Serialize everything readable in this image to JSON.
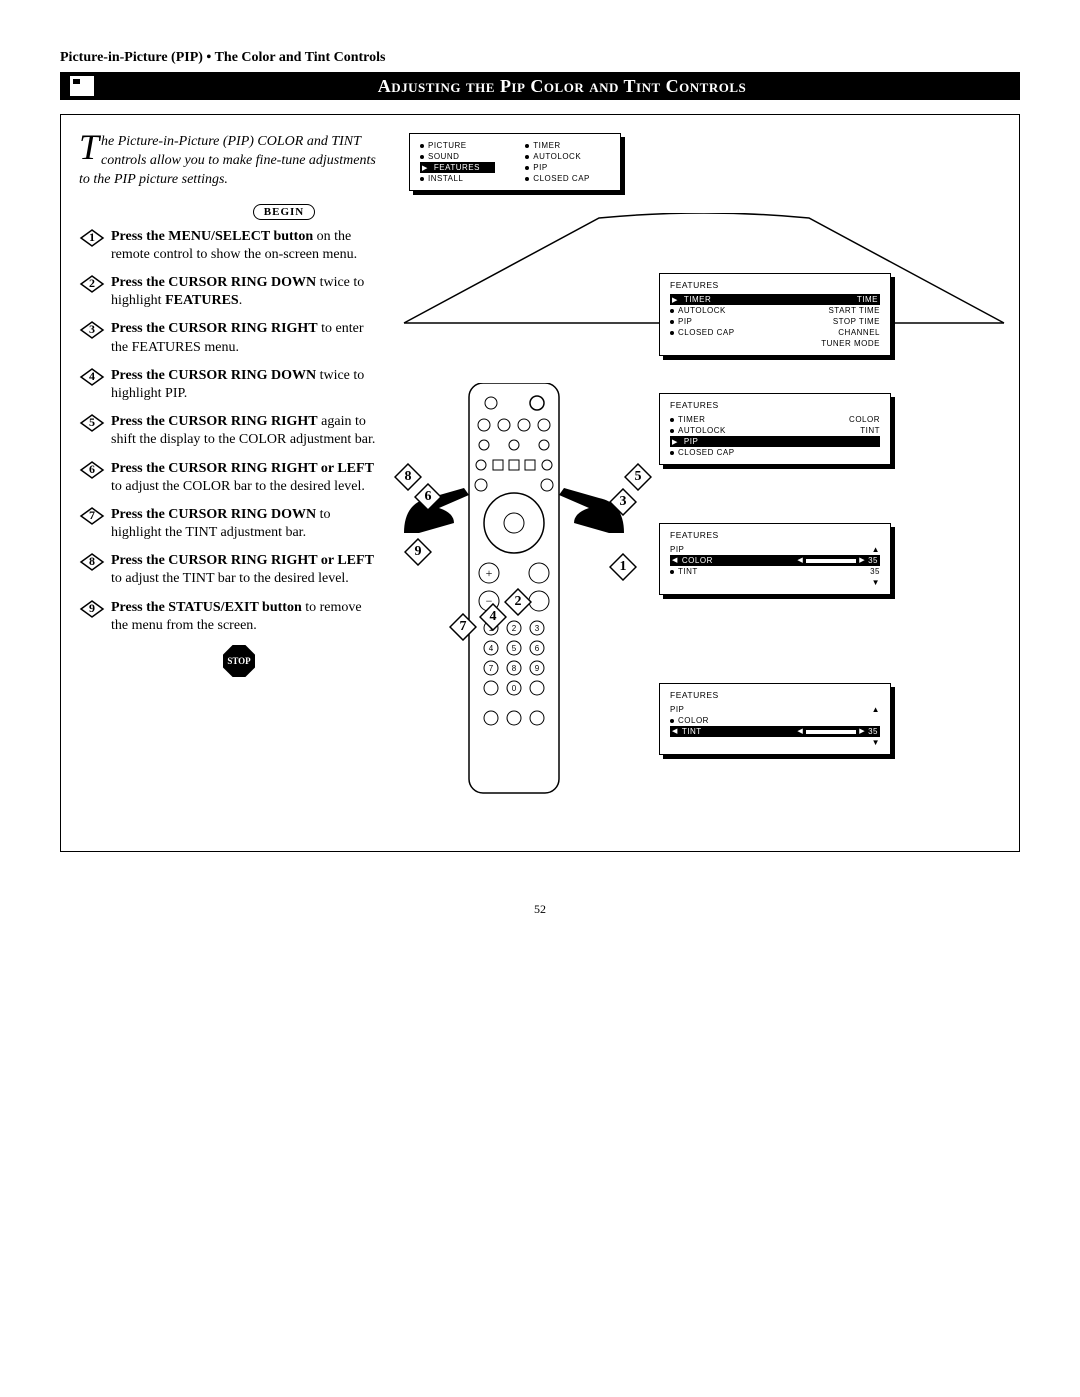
{
  "breadcrumb": "Picture-in-Picture (PIP) • The Color and Tint Controls",
  "title": "Adjusting the Pip Color and Tint Controls",
  "intro_dropcap": "T",
  "intro": "he Picture-in-Picture (PIP) COLOR and TINT controls allow you to make fine-tune adjustments to the PIP picture settings.",
  "begin_label": "BEGIN",
  "stop_label": "STOP",
  "steps": [
    {
      "n": "1",
      "bold": "Press the MENU/SELECT button",
      "rest": " on the remote control to show the on-screen menu."
    },
    {
      "n": "2",
      "bold": "Press the CURSOR RING DOWN",
      "rest": " twice to highlight ",
      "bold2": "FEATURES",
      "rest2": "."
    },
    {
      "n": "3",
      "bold": "Press the CURSOR RING RIGHT",
      "rest": " to enter the FEATURES menu."
    },
    {
      "n": "4",
      "bold": "Press the CURSOR RING DOWN",
      "rest": " twice to highlight PIP."
    },
    {
      "n": "5",
      "bold": "Press the CURSOR RING RIGHT",
      "rest": " again to shift the display to the COLOR adjustment bar."
    },
    {
      "n": "6",
      "bold": "Press the CURSOR RING RIGHT or LEFT",
      "rest": " to adjust the COLOR bar to the desired level."
    },
    {
      "n": "7",
      "bold": "Press the CURSOR RING DOWN",
      "rest": " to highlight the TINT adjustment bar."
    },
    {
      "n": "8",
      "bold": "Press the CURSOR RING RIGHT or LEFT",
      "rest": " to adjust the TINT bar to the desired level."
    },
    {
      "n": "9",
      "bold": "Press the STATUS/EXIT button",
      "rest": " to remove the menu from the screen."
    }
  ],
  "menu_main": {
    "col_a": [
      {
        "label": "PICTURE"
      },
      {
        "label": "SOUND"
      },
      {
        "label": "FEATURES",
        "selected": true
      },
      {
        "label": "INSTALL"
      }
    ],
    "col_b": [
      {
        "label": "TIMER"
      },
      {
        "label": "AUTOLOCK"
      },
      {
        "label": "PIP"
      },
      {
        "label": "CLOSED CAP"
      }
    ]
  },
  "menu_feat1": {
    "title": "FEATURES",
    "items": [
      {
        "label": "TIMER",
        "selected": true,
        "val": "TIME"
      },
      {
        "label": "AUTOLOCK",
        "val": "START TIME"
      },
      {
        "label": "PIP",
        "val": "STOP TIME"
      },
      {
        "label": "CLOSED CAP",
        "val": "CHANNEL"
      },
      {
        "label": "",
        "val": "TUNER MODE"
      }
    ]
  },
  "menu_feat2": {
    "title": "FEATURES",
    "items": [
      {
        "label": "TIMER",
        "val": "COLOR"
      },
      {
        "label": "AUTOLOCK",
        "val": "TINT"
      },
      {
        "label": "PIP",
        "selected": true
      },
      {
        "label": "CLOSED CAP"
      }
    ]
  },
  "menu_feat3": {
    "title": "FEATURES",
    "subtitle": "PIP",
    "items": [
      {
        "label": "COLOR",
        "selected": true,
        "slider": 35,
        "up": true
      },
      {
        "label": "TINT",
        "val": "35",
        "down": true
      }
    ]
  },
  "menu_feat4": {
    "title": "FEATURES",
    "subtitle": "PIP",
    "items": [
      {
        "label": "COLOR",
        "up": true
      },
      {
        "label": "TINT",
        "selected": true,
        "slider": 35,
        "down": true
      }
    ]
  },
  "diagram_labels": [
    "1",
    "2",
    "3",
    "4",
    "5",
    "6",
    "7",
    "8",
    "9"
  ],
  "page_number": "52"
}
